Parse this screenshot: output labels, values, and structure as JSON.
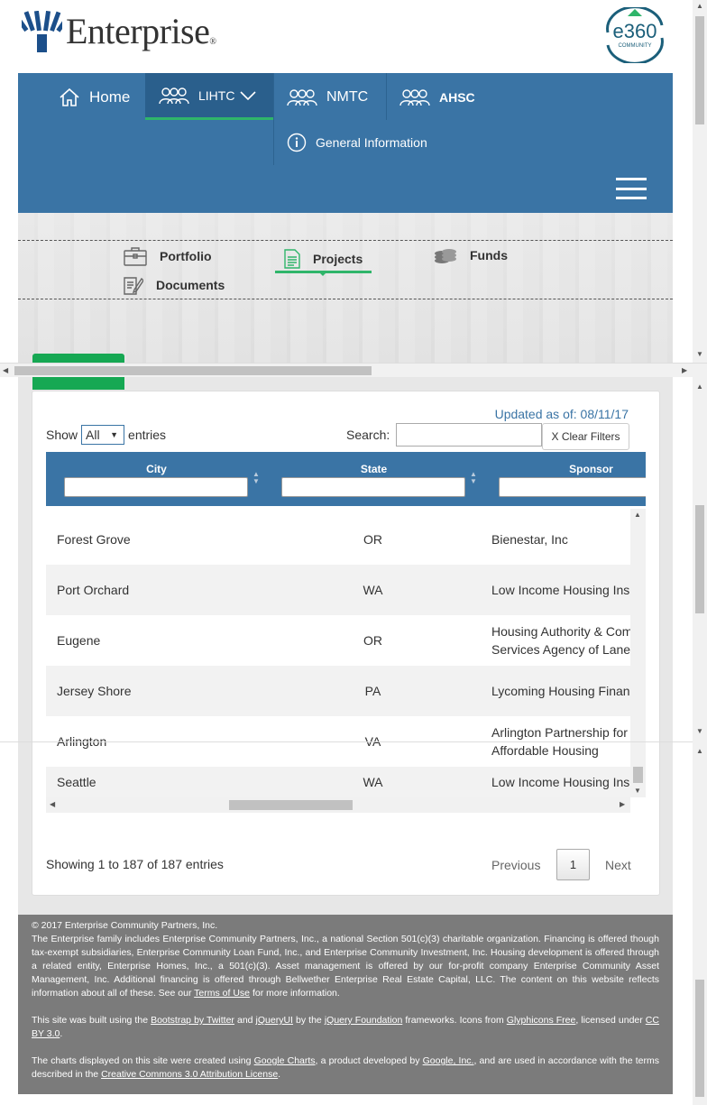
{
  "brand": {
    "name": "Enterprise",
    "mark": "®",
    "badge_top": "e360",
    "badge_bottom": "COMMUNITY"
  },
  "nav": {
    "home": "Home",
    "lihtc": "LIHTC",
    "nmtc": "NMTC",
    "ahsc": "AHSC",
    "info": "General Information"
  },
  "subnav": {
    "portfolio": "Portfolio",
    "projects": "Projects",
    "funds": "Funds",
    "documents": "Documents"
  },
  "table_controls": {
    "updated": "Updated as of: 08/11/17",
    "show_label": "Show",
    "show_value": "All",
    "entries_label": "entries",
    "search_label": "Search:",
    "clear_filters": "X Clear Filters"
  },
  "table": {
    "columns": [
      "City",
      "State",
      "Sponsor"
    ],
    "rows": [
      {
        "city": "Forest Grove",
        "state": "OR",
        "sponsor": "Bienestar, Inc"
      },
      {
        "city": "Port Orchard",
        "state": "WA",
        "sponsor": "Low Income Housing Ins"
      },
      {
        "city": "Eugene",
        "state": "OR",
        "sponsor": "Housing Authority & Com\nServices Agency of Lane"
      },
      {
        "city": "Jersey Shore",
        "state": "PA",
        "sponsor": "Lycoming Housing Finan"
      },
      {
        "city": "Arlington",
        "state": "VA",
        "sponsor": "Arlington Partnership for\nAffordable Housing"
      },
      {
        "city": "Seattle",
        "state": "WA",
        "sponsor": "Low Income Housing Ins"
      }
    ]
  },
  "pagination": {
    "info": "Showing 1 to 187 of 187 entries",
    "previous": "Previous",
    "current": "1",
    "next": "Next"
  },
  "footer": {
    "copyright": "© 2017 Enterprise Community Partners, Inc.",
    "para1_a": "The Enterprise family includes Enterprise Community Partners, Inc., a national Section 501(c)(3) charitable organization. Financing is offered though tax-exempt subsidiaries, Enterprise Community Loan Fund, Inc., and Enterprise Community Investment, Inc. Housing development is offered through a related entity, Enterprise Homes, Inc., a 501(c)(3). Asset management is offered by our for-profit company Enterprise Community Asset Management, Inc. Additional financing is offered through Bellwether Enterprise Real Estate Capital, LLC. The content on this website reflects information about all of these. See our ",
    "terms": "Terms of Use",
    "para1_b": " for more information.",
    "para2_a": "This site was built using the ",
    "bootstrap": "Bootstrap by Twitter",
    "and": " and ",
    "jqueryui": "jQueryUI",
    "by_the": " by the ",
    "jquery_foundation": "jQuery Foundation",
    "para2_b": " frameworks. Icons from ",
    "glyphicons": "Glyphicons Free",
    "para2_c": ", licensed under ",
    "ccby": "CC BY 3.0",
    "para2_d": ".",
    "para3_a": "The charts displayed on this site were created using ",
    "google_charts": "Google Charts",
    "para3_b": ", a product developed by ",
    "google_inc": "Google, Inc.",
    "para3_c": ", and are used in accordance with the terms described in the ",
    "cc_attr": "Creative Commons 3.0 Attribution License",
    "para3_d": "."
  }
}
